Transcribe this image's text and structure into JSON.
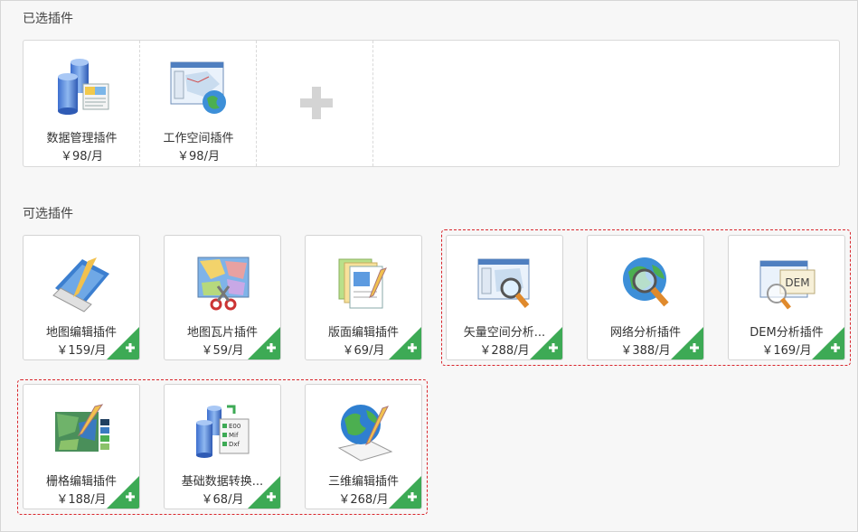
{
  "selected_section": {
    "title": "已选插件",
    "items": [
      {
        "name": "数据管理插件",
        "price": "￥98/月",
        "icon": "database-icon"
      },
      {
        "name": "工作空间插件",
        "price": "￥98/月",
        "icon": "workspace-map-icon"
      }
    ],
    "add_icon": "plus-icon"
  },
  "optional_section": {
    "title": "可选插件",
    "items": [
      {
        "name": "地图编辑插件",
        "price": "￥159/月",
        "icon": "map-edit-icon"
      },
      {
        "name": "地图瓦片插件",
        "price": "￥59/月",
        "icon": "map-tile-icon"
      },
      {
        "name": "版面编辑插件",
        "price": "￥69/月",
        "icon": "layout-edit-icon"
      },
      {
        "name": "矢量空间分析...",
        "price": "￥288/月",
        "icon": "vector-analysis-icon"
      },
      {
        "name": "网络分析插件",
        "price": "￥388/月",
        "icon": "network-analysis-icon"
      },
      {
        "name": "DEM分析插件",
        "price": "￥169/月",
        "icon": "dem-analysis-icon"
      },
      {
        "name": "栅格编辑插件",
        "price": "￥188/月",
        "icon": "raster-edit-icon"
      },
      {
        "name": "基础数据转换...",
        "price": "￥68/月",
        "icon": "data-convert-icon"
      },
      {
        "name": "三维编辑插件",
        "price": "￥268/月",
        "icon": "globe-edit-icon"
      }
    ],
    "dem_label": "DEM",
    "convert_labels": [
      "E00",
      "Mif",
      "Dxf"
    ]
  },
  "colors": {
    "accent_green": "#3daa55",
    "highlight_dash": "#d9262c",
    "plus_gray": "#d4d4d4"
  }
}
